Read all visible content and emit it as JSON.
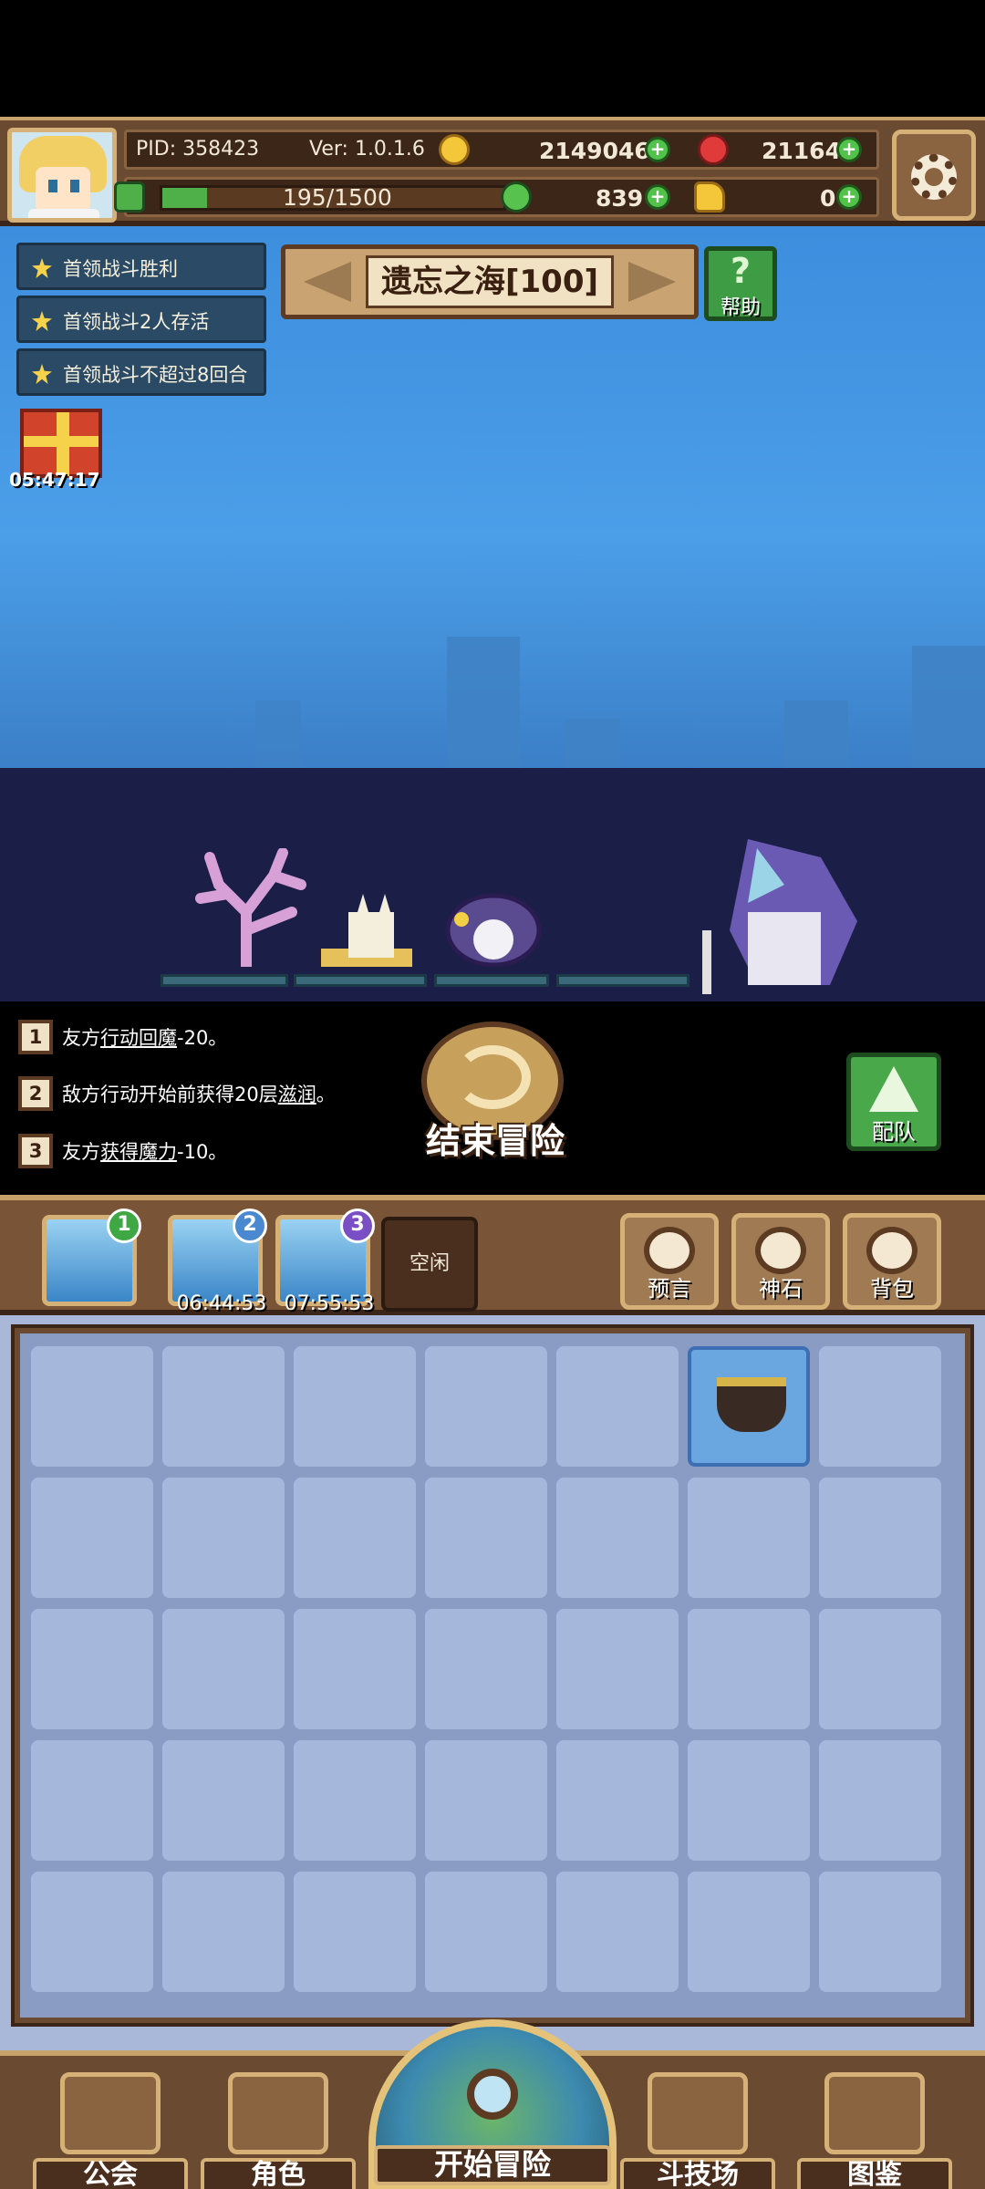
{
  "hud": {
    "pid": "PID: 358423",
    "version": "Ver: 1.0.1.6",
    "gold": "2149046",
    "gems": "21164",
    "stamina": "195/1500",
    "stamina_fraction": 0.13,
    "clover": "839",
    "key": "0"
  },
  "quests": [
    "首领战斗胜利",
    "首领战斗2人存活",
    "首领战斗不超过8回合"
  ],
  "gift_timer": "05:47:17",
  "stage": {
    "title": "遗忘之海[100]",
    "help_label": "帮助"
  },
  "battle_log": [
    {
      "num": "1",
      "pre": "友方",
      "ul1": "行动回魔",
      "mid": "-20。",
      "ul2": "",
      "post": ""
    },
    {
      "num": "2",
      "pre": "敌方行动开始前获得20层",
      "ul1": "滋润",
      "mid": "。",
      "ul2": "",
      "post": ""
    },
    {
      "num": "3",
      "pre": "友方",
      "ul1": "获得",
      "mid": "",
      "ul2": "魔力",
      "post": "-10。"
    }
  ],
  "end_adventure": "结束冒险",
  "team_label": "配队",
  "slots": [
    {
      "badge": "1",
      "timer": "",
      "badge_color": "#3fa844"
    },
    {
      "badge": "2",
      "timer": "06:44:53",
      "badge_color": "#4a88d0"
    },
    {
      "badge": "3",
      "timer": "07:55:53",
      "badge_color": "#7a4ec4"
    }
  ],
  "idle_label": "空闲",
  "side_buttons": [
    "预言",
    "神石",
    "背包"
  ],
  "nav": {
    "guild": "公会",
    "role": "角色",
    "start": "开始冒险",
    "arena": "斗技场",
    "codex": "图鉴"
  }
}
